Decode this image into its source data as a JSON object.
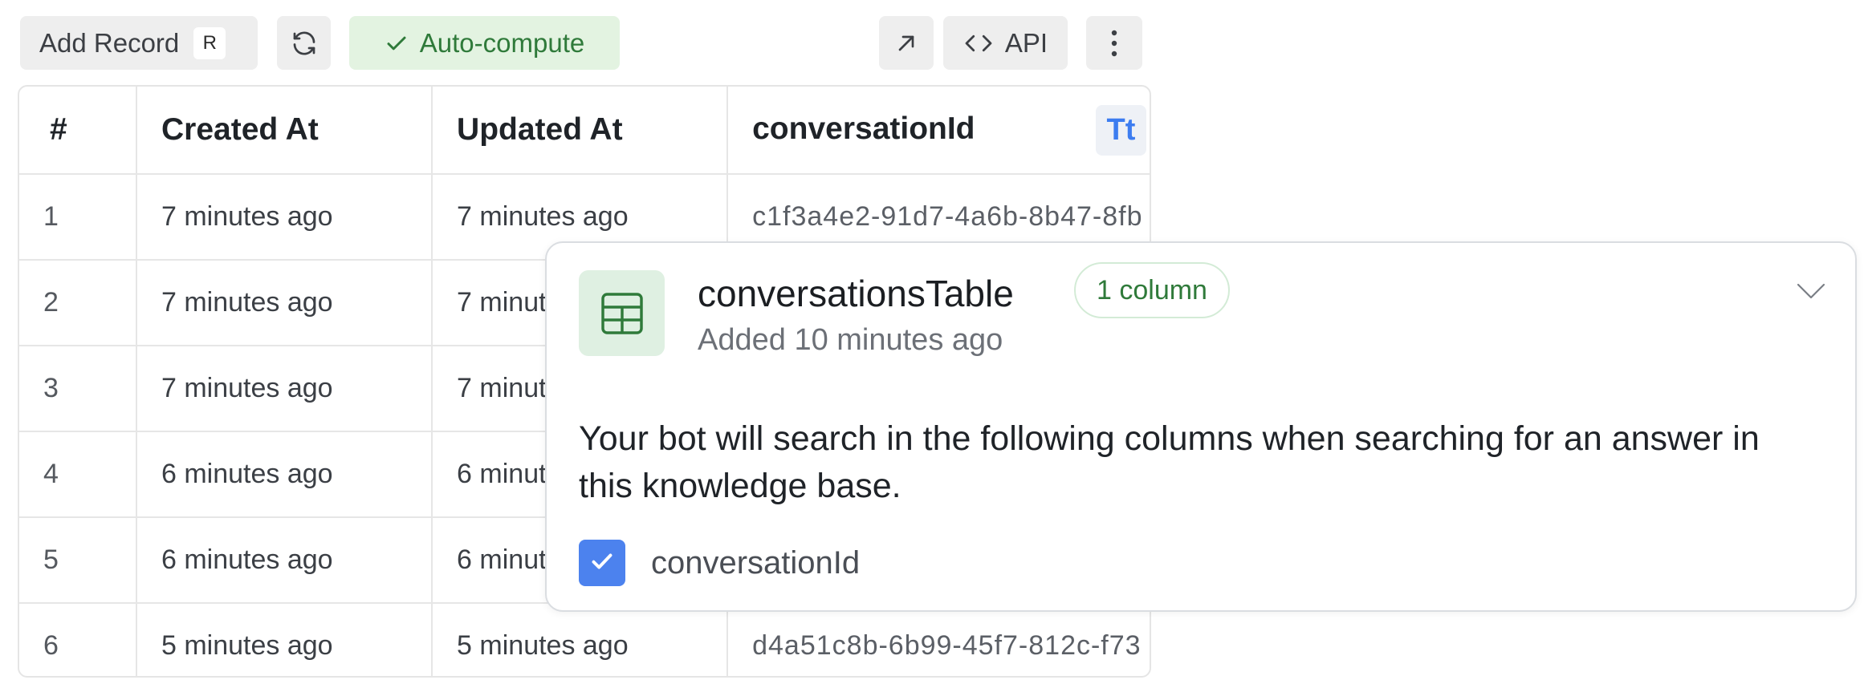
{
  "toolbar": {
    "add_record_label": "Add Record",
    "add_record_shortcut": "R",
    "auto_compute_label": "Auto-compute",
    "api_label": "API"
  },
  "table": {
    "columns": [
      "#",
      "Created At",
      "Updated At",
      "conversationId"
    ],
    "column_type_badge": "Tt",
    "rows": [
      {
        "num": "1",
        "created": "7 minutes ago",
        "updated": "7 minutes ago",
        "conversationId": "c1f3a4e2-91d7-4a6b-8b47-8fb"
      },
      {
        "num": "2",
        "created": "7 minutes ago",
        "updated": "7 minut",
        "conversationId": ""
      },
      {
        "num": "3",
        "created": "7 minutes ago",
        "updated": "7 minut",
        "conversationId": ""
      },
      {
        "num": "4",
        "created": "6 minutes ago",
        "updated": "6 minut",
        "conversationId": ""
      },
      {
        "num": "5",
        "created": "6 minutes ago",
        "updated": "6 minut",
        "conversationId": ""
      },
      {
        "num": "6",
        "created": "5 minutes ago",
        "updated": "5 minutes ago",
        "conversationId": "d4a51c8b-6b99-45f7-812c-f73"
      }
    ]
  },
  "popover": {
    "title": "conversationsTable",
    "badge": "1 column",
    "subtitle": "Added 10 minutes ago",
    "description": "Your bot will search in the following columns when searching for an answer in this knowledge base.",
    "columns": [
      {
        "label": "conversationId",
        "checked": true
      }
    ]
  },
  "colors": {
    "accent": "#4c82ee",
    "success_bg": "#e3f3e1",
    "success_text": "#2f7a3a",
    "table_icon_bg": "#dff0e2"
  },
  "icons": {
    "refresh": "refresh-icon",
    "check": "check-icon",
    "expand": "expand-arrow-icon",
    "api": "code-icon",
    "more": "more-vertical-icon",
    "table": "table-icon",
    "chevron": "chevron-down-icon"
  }
}
